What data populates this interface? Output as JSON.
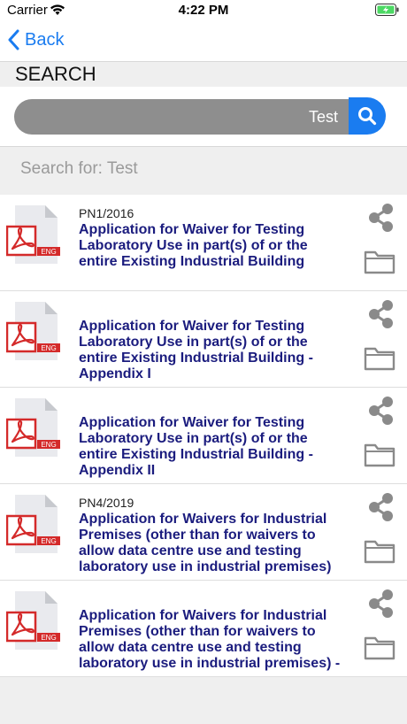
{
  "status_bar": {
    "carrier": "Carrier",
    "time": "4:22 PM"
  },
  "nav": {
    "back_label": "Back"
  },
  "page": {
    "title": "SEARCH"
  },
  "search": {
    "value": "Test",
    "search_for": "Search for: Test"
  },
  "colors": {
    "accent": "#1a7cf0",
    "title_text": "#1b1c7e",
    "pdf_red": "#d42a2a",
    "icon_gray": "#8a8a8a"
  },
  "results": [
    {
      "ref": "PN1/2016",
      "badge": "ENG",
      "title": "Application for Waiver for Testing Laboratory Use in part(s) of or the entire Existing Industrial Building"
    },
    {
      "ref": "",
      "badge": "ENG",
      "title": "Application for Waiver for Testing Laboratory Use in part(s) of or the entire Existing Industrial Building - Appendix I"
    },
    {
      "ref": "",
      "badge": "ENG",
      "title": "Application for Waiver for Testing Laboratory Use in part(s) of or the entire Existing Industrial Building - Appendix II"
    },
    {
      "ref": "PN4/2019",
      "badge": "ENG",
      "title": "Application for Waivers for Industrial Premises (other than for waivers to allow data centre use and testing laboratory use in industrial premises)"
    },
    {
      "ref": "",
      "badge": "ENG",
      "title": "Application for Waivers for Industrial Premises (other than for waivers to allow data centre use and testing laboratory use in industrial premises) -"
    }
  ],
  "icons": {
    "file": "pdf-file-icon",
    "share": "share-icon",
    "folder": "folder-icon",
    "search": "search-icon",
    "back": "chevron-left-icon"
  }
}
